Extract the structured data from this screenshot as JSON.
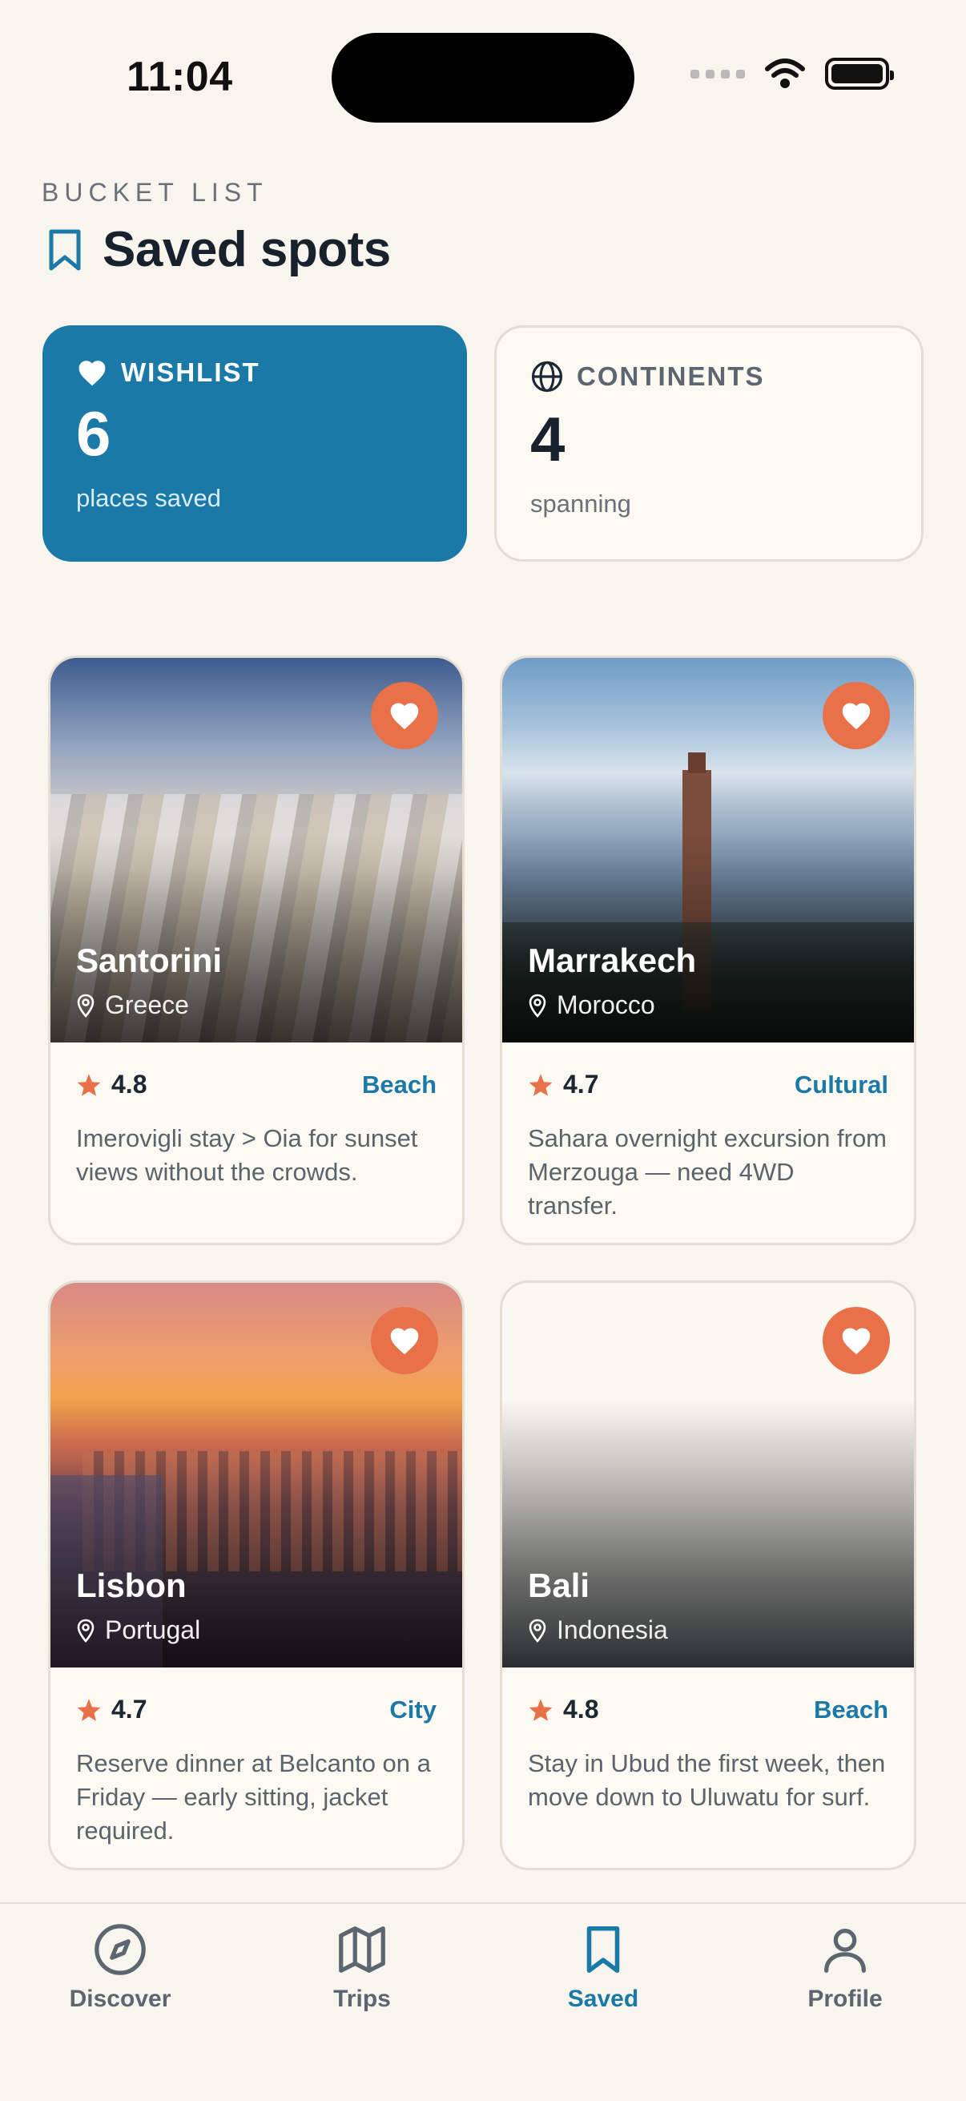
{
  "status": {
    "time": "11:04"
  },
  "header": {
    "eyebrow": "BUCKET LIST",
    "title": "Saved spots"
  },
  "stats": {
    "wishlist": {
      "label": "WISHLIST",
      "value": "6",
      "sub": "places saved"
    },
    "continents": {
      "label": "CONTINENTS",
      "value": "4",
      "sub": "spanning"
    }
  },
  "places": [
    {
      "name": "Santorini",
      "location": "Greece",
      "rating": "4.8",
      "tag": "Beach",
      "note": "Imerovigli stay > Oia for sunset views without the crowds."
    },
    {
      "name": "Marrakech",
      "location": "Morocco",
      "rating": "4.7",
      "tag": "Cultural",
      "note": "Sahara overnight excursion from Merzouga — need 4WD transfer."
    },
    {
      "name": "Lisbon",
      "location": "Portugal",
      "rating": "4.7",
      "tag": "City",
      "note": "Reserve dinner at Belcanto on a Friday — early sitting, jacket required."
    },
    {
      "name": "Bali",
      "location": "Indonesia",
      "rating": "4.8",
      "tag": "Beach",
      "note": "Stay in Ubud the first week, then move down to Uluwatu for surf."
    }
  ],
  "tabs": [
    {
      "label": "Discover",
      "icon": "compass-icon"
    },
    {
      "label": "Trips",
      "icon": "map-icon"
    },
    {
      "label": "Saved",
      "icon": "bookmark-icon"
    },
    {
      "label": "Profile",
      "icon": "person-icon"
    }
  ],
  "colors": {
    "accent": "#1b79a8",
    "favorite": "#e8714a",
    "background": "#f8f4ee"
  }
}
